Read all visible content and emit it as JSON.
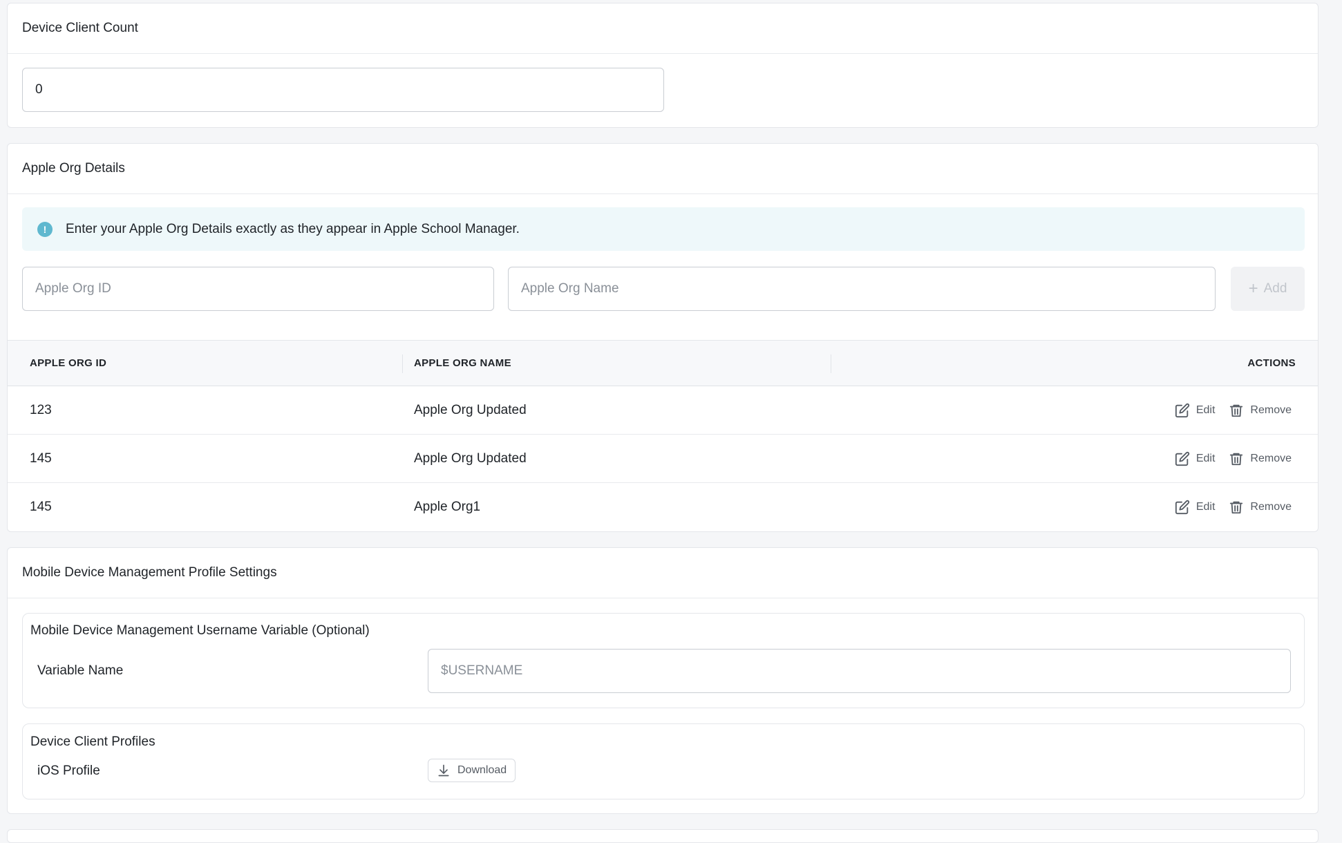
{
  "device_client_count": {
    "title": "Device Client Count",
    "value": "0"
  },
  "apple_org": {
    "title": "Apple Org Details",
    "info": "Enter your Apple Org Details exactly as they appear in Apple School Manager.",
    "id_placeholder": "Apple Org ID",
    "name_placeholder": "Apple Org Name",
    "add_label": "Add",
    "columns": {
      "id": "APPLE ORG ID",
      "name": "APPLE ORG NAME",
      "actions": "ACTIONS"
    },
    "rows": [
      {
        "id": "123",
        "name": "Apple Org Updated"
      },
      {
        "id": "145",
        "name": "Apple Org Updated"
      },
      {
        "id": "145",
        "name": "Apple Org1"
      }
    ],
    "edit_label": "Edit",
    "remove_label": "Remove"
  },
  "mdm": {
    "title": "Mobile Device Management Profile Settings",
    "username_section": {
      "title": "Mobile Device Management Username Variable (Optional)",
      "label": "Variable Name",
      "placeholder": "$USERNAME"
    },
    "profiles_section": {
      "title": "Device Client Profiles",
      "label": "iOS Profile",
      "download_label": "Download"
    }
  },
  "colors": {
    "info_bg": "#eef8fa",
    "info_icon": "#5fb8cf",
    "border": "#e4e6ea"
  }
}
